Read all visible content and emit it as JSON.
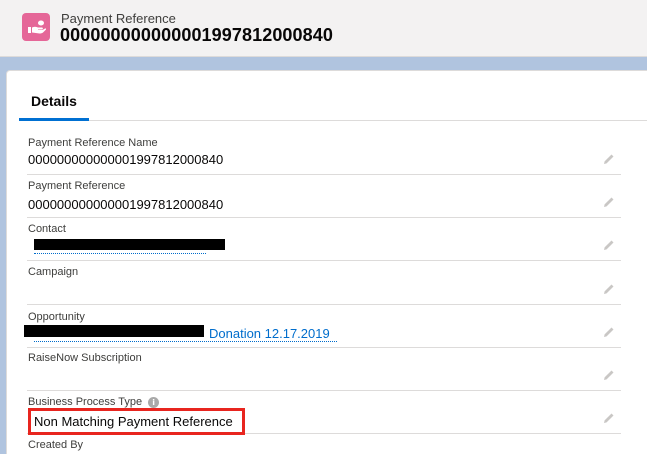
{
  "header": {
    "object_label": "Payment Reference",
    "record_title": "000000000000001997812000840",
    "icon": "hand-coin-icon",
    "icon_color": "#e56798"
  },
  "tabs": [
    {
      "label": "Details",
      "active": true
    }
  ],
  "fields": [
    {
      "label": "Payment Reference Name",
      "value": "000000000000001997812000840"
    },
    {
      "label": "Payment Reference",
      "value": "000000000000001997812000840"
    },
    {
      "label": "Contact",
      "value": ""
    },
    {
      "label": "Campaign",
      "value": ""
    },
    {
      "label": "Opportunity",
      "value": "Donation 12.17.2019"
    },
    {
      "label": "RaiseNow Subscription",
      "value": ""
    },
    {
      "label": "Business Process Type",
      "value": "Non Matching Payment Reference"
    },
    {
      "label": "Created By",
      "value": ""
    }
  ],
  "colors": {
    "accent": "#0070d2",
    "link": "#006dcc",
    "highlight": "#e8251f"
  }
}
